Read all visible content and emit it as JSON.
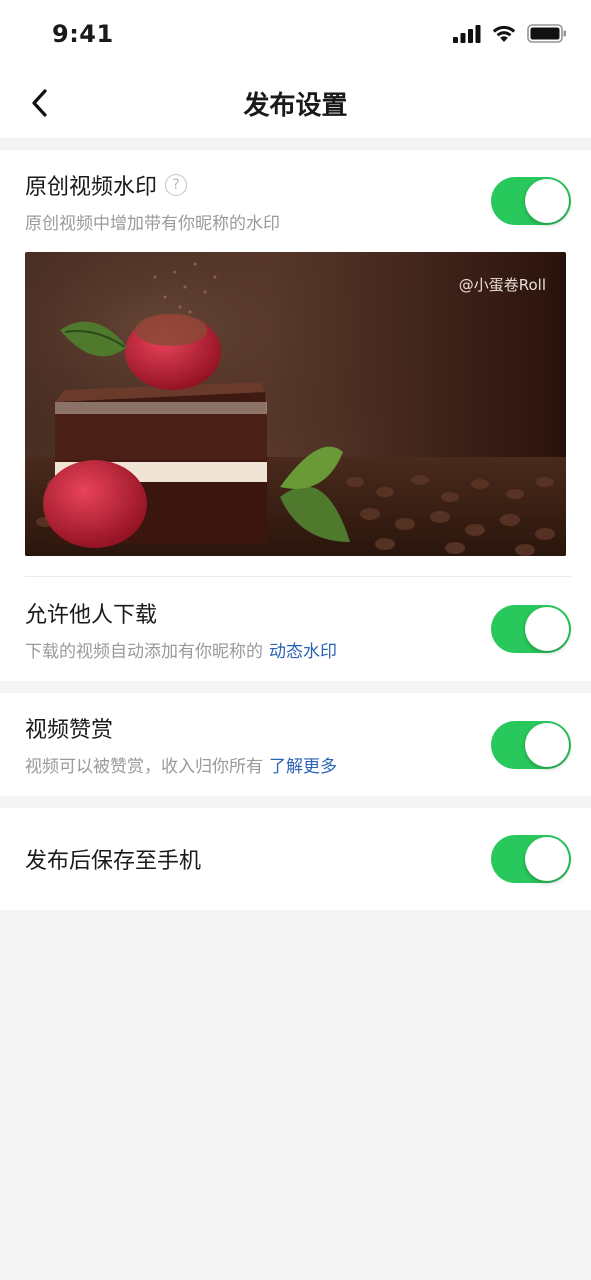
{
  "status_bar": {
    "time": "9:41"
  },
  "nav": {
    "title": "发布设置"
  },
  "watermark_setting": {
    "title": "原创视频水印",
    "help": "?",
    "desc": "原创视频中增加带有你昵称的水印",
    "enabled": true,
    "preview_watermark": "@小蛋卷Roll"
  },
  "download_setting": {
    "title": "允许他人下载",
    "desc": "下载的视频自动添加有你昵称的",
    "link": "动态水印",
    "enabled": true
  },
  "reward_setting": {
    "title": "视频赞赏",
    "desc": "视频可以被赞赏，收入归你所有",
    "link": "了解更多",
    "enabled": true
  },
  "save_setting": {
    "title": "发布后保存至手机",
    "enabled": true
  },
  "colors": {
    "toggle_on": "#29c85c",
    "link": "#2b63b6"
  }
}
